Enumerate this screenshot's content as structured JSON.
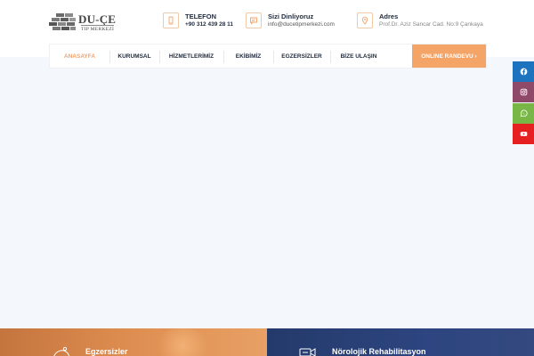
{
  "logo": {
    "name": "DU-ÇE",
    "subtitle": "TIP MERKEZİ"
  },
  "contact": {
    "phone": {
      "title": "TELEFON",
      "value": "+90 312 439 28 11",
      "icon": "phone-icon"
    },
    "email": {
      "title": "Sizi Dinliyoruz",
      "value": "info@ducetipmerkezi.com",
      "icon": "chat-icon"
    },
    "address": {
      "title": "Adres",
      "value": "Prof.Dr. Aziz Sancar Cad. No:9 Çankaya",
      "icon": "location-pin-icon"
    }
  },
  "nav": {
    "items": [
      {
        "label": "ANASAYFA",
        "active": true
      },
      {
        "label": "KURUMSAL",
        "active": false
      },
      {
        "label": "HİZMETLERİMİZ",
        "active": false
      },
      {
        "label": "EKİBİMİZ",
        "active": false
      },
      {
        "label": "EGZERSİZLER",
        "active": false
      },
      {
        "label": "BİZE ULAŞIN",
        "active": false
      }
    ],
    "cta": "ONLINE RANDEVU  ›"
  },
  "social": [
    {
      "name": "facebook-icon",
      "color": "#1e73be"
    },
    {
      "name": "instagram-icon",
      "color": "#8f4a6a"
    },
    {
      "name": "whatsapp-icon",
      "color": "#78b645"
    },
    {
      "name": "youtube-icon",
      "color": "#e62020"
    }
  ],
  "cards": {
    "left": {
      "title": "Egzersizler",
      "color": "#dd8c4f"
    },
    "right": {
      "title": "Nörolojik Rehabilitasyon",
      "color": "#2d4580"
    }
  },
  "colors": {
    "accent": "#f4a466",
    "nav_text": "#1f2a3c",
    "background": "#f4f7fb"
  }
}
